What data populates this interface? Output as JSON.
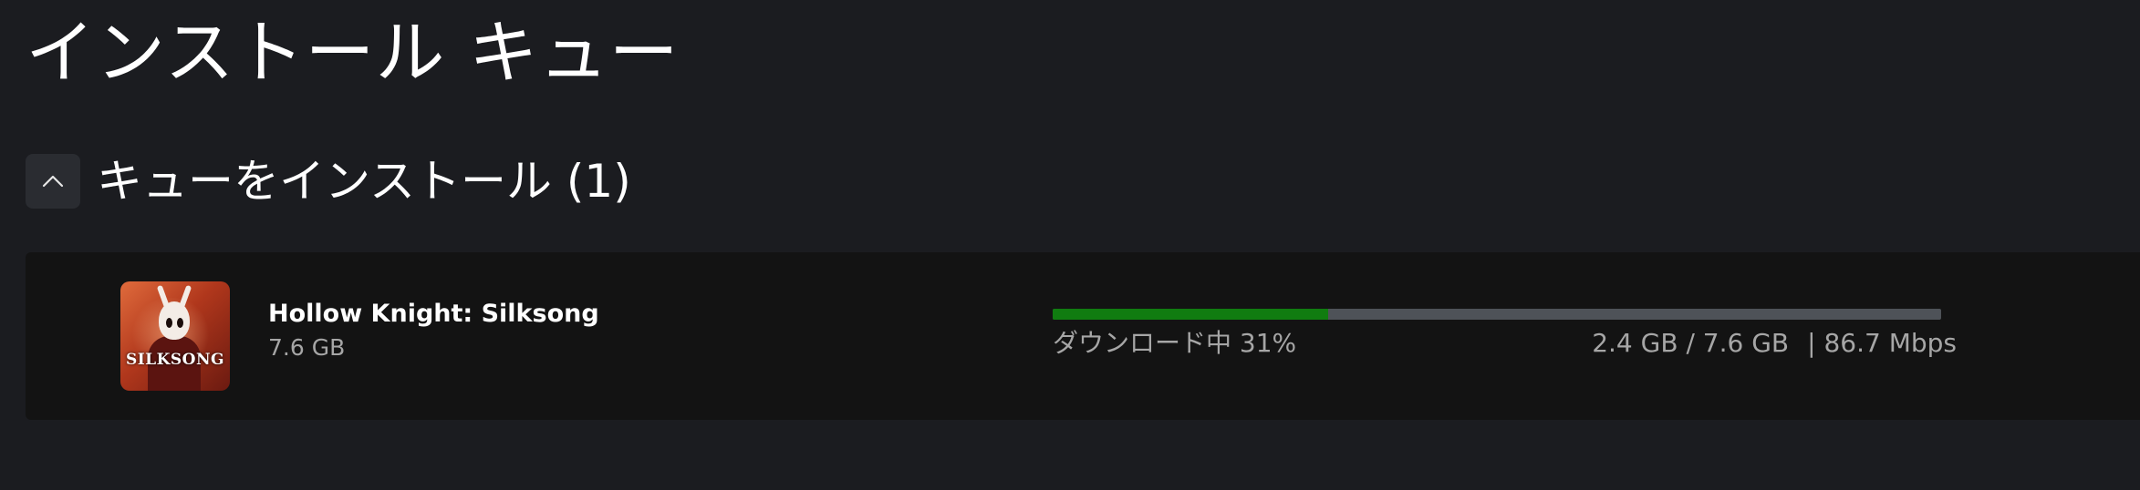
{
  "page": {
    "title": "インストール キュー"
  },
  "section": {
    "title": "キューをインストール (1)",
    "collapse_icon": "chevron-up-icon"
  },
  "queue": {
    "items": [
      {
        "title": "Hollow Knight: Silksong",
        "thumbnail_text": "SILKSONG",
        "size": "7.6 GB",
        "status": "ダウンロード中 31%",
        "progress": 0.31,
        "transferred": "2.4 GB / 7.6 GB",
        "speed": "| 86.7 Mbps"
      }
    ]
  },
  "colors": {
    "background": "#1b1c20",
    "card": "#131313",
    "progress_fill": "#107c10",
    "progress_track": "#4e5258",
    "secondary_text": "#a6a6a6"
  }
}
